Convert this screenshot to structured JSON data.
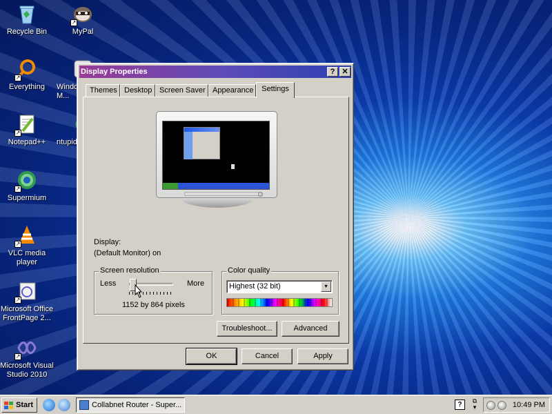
{
  "desktop": {
    "icons": [
      {
        "label": "Recycle Bin",
        "icon": "recycle-bin-icon"
      },
      {
        "label": "MyPal",
        "icon": "mypal-icon"
      },
      {
        "label": "Everything",
        "icon": "everything-icon"
      },
      {
        "label": "Windo... M...",
        "icon": "windows-app-icon"
      },
      {
        "label": "Notepad++",
        "icon": "notepad-plus-plus-icon"
      },
      {
        "label": "ntupid",
        "icon": "ntupid-icon"
      },
      {
        "label": "Supermium",
        "icon": "supermium-icon"
      },
      {
        "label": "VLC media player",
        "icon": "vlc-icon"
      },
      {
        "label": "Microsoft Office FrontPage 2...",
        "icon": "frontpage-icon"
      },
      {
        "label": "Microsoft Visual Studio 2010",
        "icon": "visual-studio-icon"
      }
    ]
  },
  "dialog": {
    "title": "Display Properties",
    "help_btn": "?",
    "close_btn": "✕",
    "tabs": [
      {
        "label": "Themes"
      },
      {
        "label": "Desktop"
      },
      {
        "label": "Screen Saver"
      },
      {
        "label": "Appearance"
      },
      {
        "label": "Settings",
        "active": true
      }
    ],
    "display_label": "Display:",
    "display_value": "(Default Monitor) on",
    "resolution": {
      "label": "Screen resolution",
      "less": "Less",
      "more": "More",
      "value": "1152 by 864 pixels"
    },
    "color_quality": {
      "label": "Color quality",
      "selected": "Highest (32 bit)"
    },
    "troubleshoot_btn": "Troubleshoot...",
    "advanced_btn": "Advanced",
    "ok_btn": "OK",
    "cancel_btn": "Cancel",
    "apply_btn": "Apply"
  },
  "taskbar": {
    "start_label": "Start",
    "active_task": "Collabnet Router - Super...",
    "clock": "10:49 PM"
  },
  "colors": {
    "title_start": "#9a3b97",
    "title_end": "#2b3fb0",
    "dialog_face": "#d4d0c8",
    "desktop_blue": "#0b3fb4"
  }
}
